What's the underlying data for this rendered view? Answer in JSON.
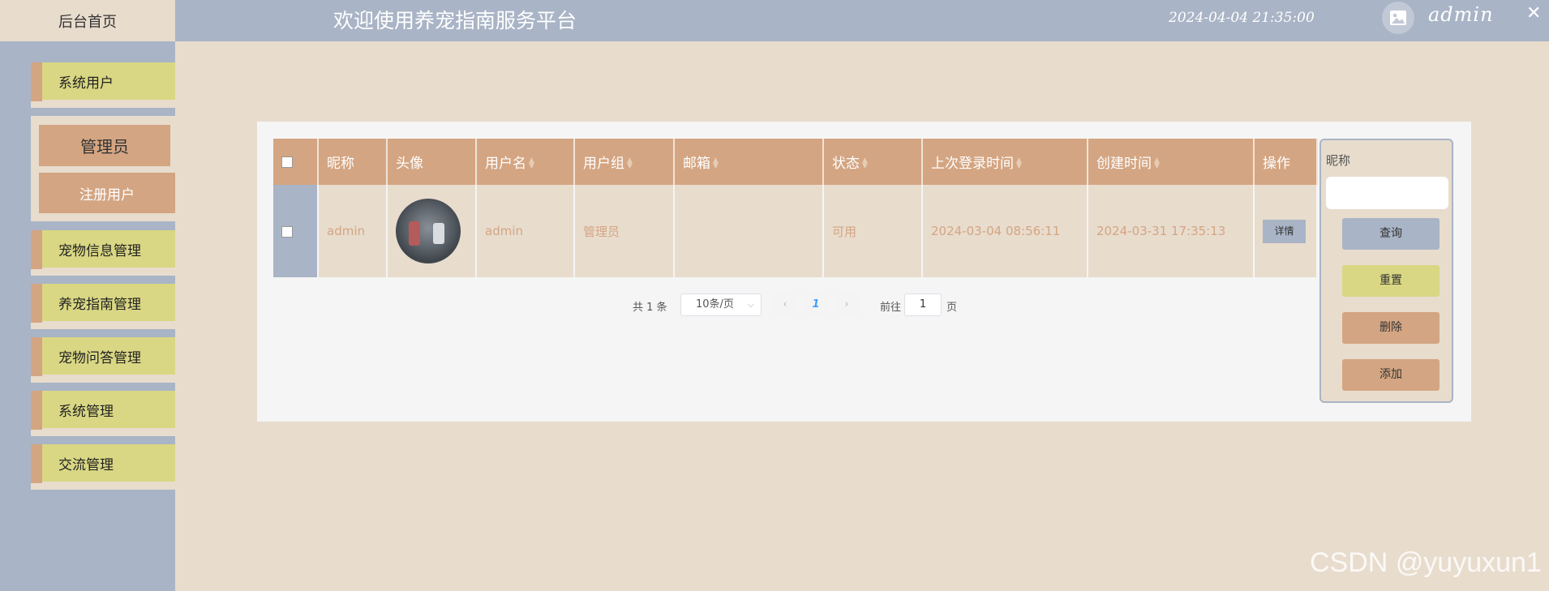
{
  "header": {
    "home_label": "后台首页",
    "title": "欢迎使用养宠指南服务平台",
    "datetime": "2024-04-04 21:35:00",
    "username": "admin",
    "close": "✕"
  },
  "sidebar": {
    "items": [
      {
        "label": "系统用户"
      },
      {
        "label": "宠物信息管理"
      },
      {
        "label": "养宠指南管理"
      },
      {
        "label": "宠物问答管理"
      },
      {
        "label": "系统管理"
      },
      {
        "label": "交流管理"
      }
    ],
    "sub_items": [
      {
        "label": "管理员"
      },
      {
        "label": "注册用户"
      }
    ]
  },
  "table": {
    "columns": [
      "昵称",
      "头像",
      "用户名",
      "用户组",
      "邮箱",
      "状态",
      "上次登录时间",
      "创建时间",
      "操作"
    ],
    "rows": [
      {
        "nickname": "admin",
        "username": "admin",
        "group": "管理员",
        "email": "",
        "status": "可用",
        "last_login": "2024-03-04 08:56:11",
        "created": "2024-03-31 17:35:13",
        "action": "详情"
      }
    ]
  },
  "pager": {
    "total": "共 1 条",
    "page_size": "10条/页",
    "current_page": "1",
    "goto_label": "前往",
    "goto_value": "1",
    "page_suffix": "页"
  },
  "search": {
    "label": "昵称",
    "query": "查询",
    "reset": "重置",
    "delete": "删除",
    "add": "添加"
  },
  "watermark": "CSDN @yuyuxun1",
  "colors": {
    "sidebar": "#a9b4c6",
    "header_cell": "#d4a582",
    "menu_face": "#d9d783",
    "page_bg": "#e8dccd"
  }
}
